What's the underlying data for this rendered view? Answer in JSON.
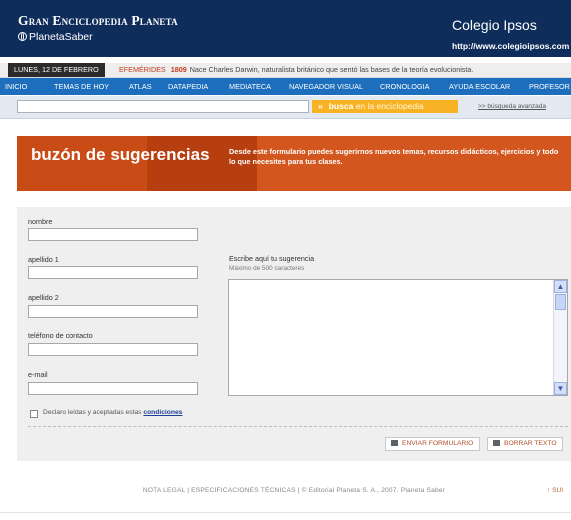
{
  "brand": {
    "title": "Gran Enciclopedia Planeta",
    "subtitle": "PlanetaSaber"
  },
  "school": {
    "name": "Colegio Ipsos",
    "url": "http://www.colegioipsos.com"
  },
  "datebar": {
    "date": "LUNES, 12 DE FEBRERO",
    "efemerides_label": "EFEMÉRIDES",
    "year": "1809",
    "text": "Nace Charles Darwin, naturalista británico que sentó las bases de la teoría evolucionista."
  },
  "nav": [
    "INICIO",
    "TEMAS DE HOY",
    "ATLAS",
    "DATAPEDIA",
    "MEDIATECA",
    "NAVEGADOR VISUAL",
    "CRONOLOGIA",
    "AYUDA ESCOLAR",
    "PROFESOR"
  ],
  "search": {
    "placeholder": "",
    "button_arrows": "»",
    "button_label_1": "busca",
    "button_label_2": "en la enciclopedia",
    "advanced": ">> búsqueda avanzada"
  },
  "banner": {
    "title": "buzón de sugerencias",
    "description": "Desde este formulario puedes sugerirnos nuevos temas, recursos didácticos, ejercicios y todo lo que necesites para tus clases."
  },
  "form": {
    "fields": [
      {
        "label": "nombre",
        "value": ""
      },
      {
        "label": "apellido 1",
        "value": ""
      },
      {
        "label": "apellido 2",
        "value": ""
      },
      {
        "label": "teléfono de contacto",
        "value": ""
      },
      {
        "label": "e-mail",
        "value": ""
      }
    ],
    "suggestion_label": "Escribe aquí tu sugerencia",
    "suggestion_hint": "Máximo de 500 caracteres",
    "suggestion_value": "",
    "consent_text": "Declaro leídas y aceptadas estas",
    "consent_link": "condiciones",
    "consent_checked": false,
    "submit_label": "ENVIAR FORMULARIO",
    "clear_label": "BORRAR TEXTO"
  },
  "footer": {
    "text": "NOTA LEGAL | ESPECIFICACIONES TÉCNICAS | © Editorial Planeta S. A., 2007. Planeta Saber",
    "back_to_top": "↑ SUI"
  },
  "colors": {
    "header": "#0f2d5a",
    "nav": "#1d6fbd",
    "banner": "#c94b16",
    "search_button": "#f7b324",
    "accent_red": "#c23a1e"
  }
}
